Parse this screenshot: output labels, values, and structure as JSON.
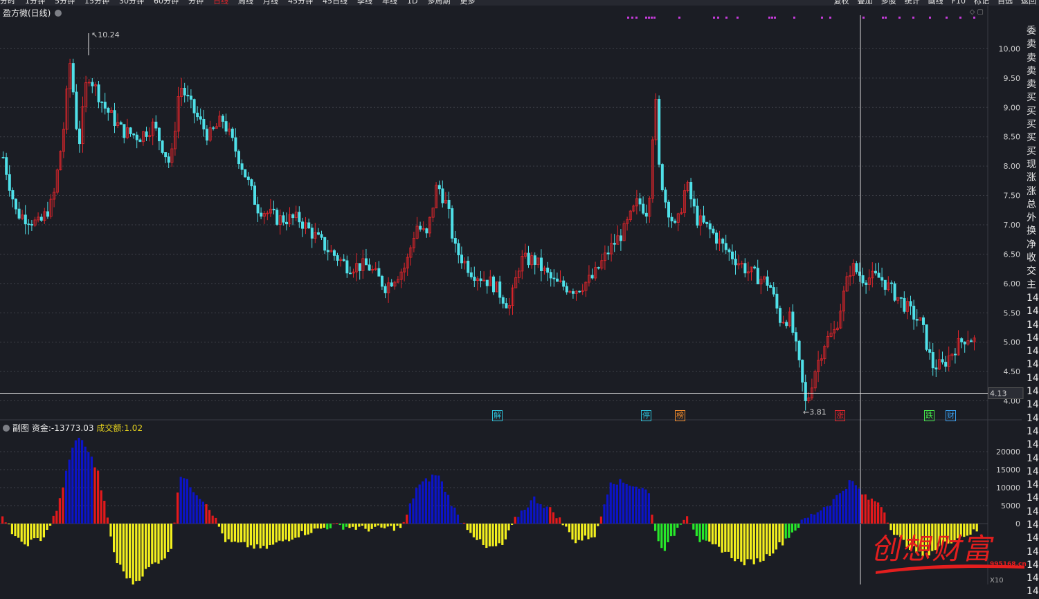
{
  "topbar": {
    "menu_items": [
      "分时",
      "1分钟",
      "5分钟",
      "15分钟",
      "30分钟",
      "60分钟",
      "分钟",
      "日线",
      "周线",
      "月线",
      "45分钟",
      "45日线",
      "季线",
      "年线",
      "1D",
      "多周期",
      "更多"
    ],
    "right_items": [
      "复权",
      "叠加",
      "多股",
      "统计",
      "画线",
      "F10",
      "标记",
      "自选",
      "返回"
    ]
  },
  "main_chart": {
    "title": "盈方微(日线)",
    "y_ticks": [
      "10.00",
      "9.50",
      "9.00",
      "8.50",
      "8.00",
      "7.50",
      "7.00",
      "6.50",
      "6.00",
      "5.50",
      "5.00",
      "4.50",
      "4.00"
    ],
    "high_label": "10.24",
    "low_label": "3.81",
    "price_line_label": "4.13",
    "marker_labels": [
      "解",
      "停",
      "榜",
      "涨",
      "跌",
      "财"
    ],
    "colors": {
      "up": "#e3252b",
      "down": "#4fe0e8",
      "background": "#1b1d24",
      "marker": "#c43bd9"
    }
  },
  "sub_chart": {
    "title": "副图",
    "fund_label": "资金:",
    "fund_value": "-13773.03",
    "volume_label": "成交额:",
    "volume_value": "1.02",
    "y_ticks": [
      "20000",
      "15000",
      "10000",
      "5000",
      "0"
    ],
    "colors": {
      "blue": "#0c14c8",
      "red": "#e3191c",
      "yellow": "#f3f01e",
      "green": "#27e82a"
    }
  },
  "right_column": [
    "委",
    "卖",
    "卖",
    "卖",
    "卖",
    "买",
    "买",
    "买",
    "买",
    "买",
    "现",
    "涨",
    "涨",
    "总",
    "外",
    "换",
    "净",
    "收",
    "交",
    "主",
    "14",
    "14",
    "14",
    "14",
    "14",
    "14",
    "14",
    "14",
    "14",
    "14",
    "14",
    "14",
    "14",
    "14",
    "14",
    "14",
    "14",
    "14",
    "14",
    "14",
    "14",
    "14",
    "14"
  ],
  "watermark": {
    "text": "创想财富",
    "url": "995168.cn"
  },
  "zoom_label": "X10"
}
